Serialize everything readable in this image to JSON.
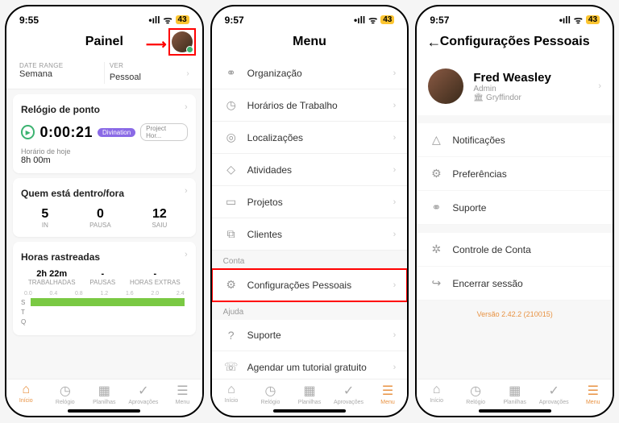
{
  "status": {
    "time1": "9:55",
    "time2": "9:57",
    "time3": "9:57",
    "signal": "••ll",
    "wifi": "⬳",
    "battery": "43"
  },
  "screen1": {
    "title": "Painel",
    "filters": {
      "dateLabel": "DATE RANGE",
      "dateValue": "Semana",
      "viewLabel": "VER",
      "viewValue": "Pessoal"
    },
    "clockCard": {
      "title": "Relógio de ponto",
      "time": "0:00:21",
      "tag1": "Divination",
      "tag2": "Project Hor...",
      "todayLabel": "Horário de hoje",
      "todayValue": "8h 00m"
    },
    "whoCard": {
      "title": "Quem está dentro/fora",
      "stats": [
        {
          "n": "5",
          "l": "IN"
        },
        {
          "n": "0",
          "l": "PAUSA"
        },
        {
          "n": "12",
          "l": "SAIU"
        }
      ]
    },
    "trackCard": {
      "title": "Horas rastreadas",
      "cols": [
        {
          "v": "2h 22m",
          "l": "TRABALHADAS"
        },
        {
          "v": "-",
          "l": "PAUSAS"
        },
        {
          "v": "-",
          "l": "HORAS EXTRAS"
        }
      ],
      "axis": [
        "0.0",
        "0.4",
        "0.8",
        "1.2",
        "1.6",
        "2.0",
        "2.4"
      ],
      "rows": [
        "S",
        "T",
        "Q"
      ]
    }
  },
  "screen2": {
    "title": "Menu",
    "items": [
      {
        "icon": "�⚭",
        "label": "Organização"
      },
      {
        "icon": "◷",
        "label": "Horários de Trabalho"
      },
      {
        "icon": "⍟",
        "label": "Localizações"
      },
      {
        "icon": "⌂",
        "label": "Atividades"
      },
      {
        "icon": "▭",
        "label": "Projetos"
      },
      {
        "icon": "⧉",
        "label": "Clientes"
      }
    ],
    "section1": "Conta",
    "personal": {
      "icon": "⚙",
      "label": "Configurações Pessoais"
    },
    "section2": "Ajuda",
    "help": [
      {
        "icon": "?",
        "label": "Suporte"
      },
      {
        "icon": "☏",
        "label": "Agendar um tutorial gratuito"
      }
    ]
  },
  "screen3": {
    "title": "Configurações Pessoais",
    "profile": {
      "name": "Fred Weasley",
      "role": "Admin",
      "org": "Gryffindor"
    },
    "items": [
      {
        "icon": "△",
        "label": "Notificações"
      },
      {
        "icon": "⚙",
        "label": "Preferências"
      },
      {
        "icon": "⚭",
        "label": "Suporte"
      },
      {
        "icon": "✲",
        "label": "Controle de Conta"
      },
      {
        "icon": "↪",
        "label": "Encerrar sessão"
      }
    ],
    "version": "Versão 2.42.2 (210015)"
  },
  "tabs": [
    {
      "icon": "⌂",
      "label": "Início"
    },
    {
      "icon": "◷",
      "label": "Relógio"
    },
    {
      "icon": "▦",
      "label": "Planilhas"
    },
    {
      "icon": "✓",
      "label": "Aprovações"
    },
    {
      "icon": "☰",
      "label": "Menu"
    }
  ]
}
